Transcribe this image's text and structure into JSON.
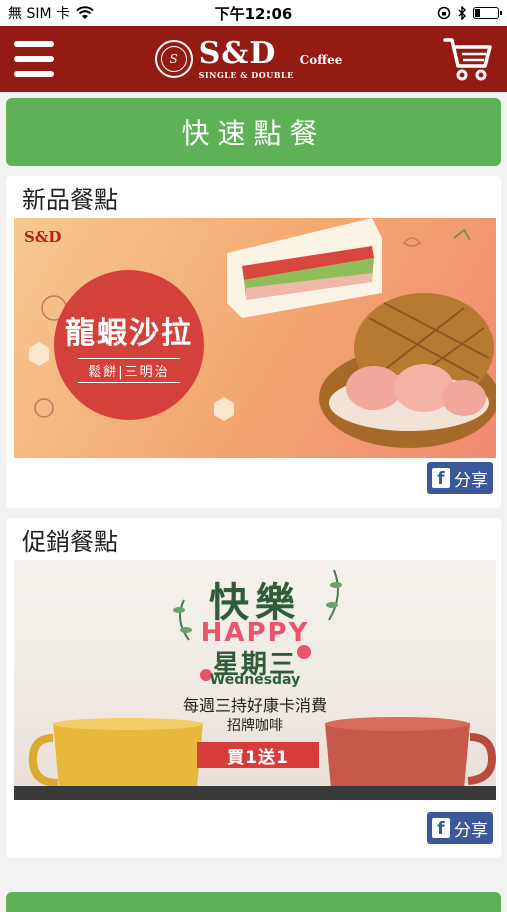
{
  "status_bar": {
    "carrier": "無 SIM 卡",
    "time": "下午12:06",
    "battery_level": 0.25
  },
  "header": {
    "brand": "S&D",
    "brand_sub": "SINGLE & DOUBLE",
    "brand_coffee": "Coffee",
    "menu_icon": "hamburger-icon",
    "cart_icon": "cart-icon"
  },
  "quick_order": {
    "label": "快速點餐"
  },
  "new_items": {
    "title": "新品餐點",
    "banner": {
      "logo_text": "S&D",
      "headline": "龍蝦沙拉",
      "subline": "鬆餅|三明治"
    },
    "share_label": "分享"
  },
  "promo_items": {
    "title": "促銷餐點",
    "banner": {
      "kuaile": "快樂",
      "happy": "HAPPY",
      "weekday": "星期三",
      "wednesday": "Wednesday",
      "line1": "每週三持好康卡消費",
      "line2": "招牌咖啡",
      "offer": "買1送1"
    },
    "share_label": "分享"
  },
  "colors": {
    "header_bg": "#941b14",
    "quick_green": "#5fb157",
    "facebook_blue": "#3b5998"
  }
}
